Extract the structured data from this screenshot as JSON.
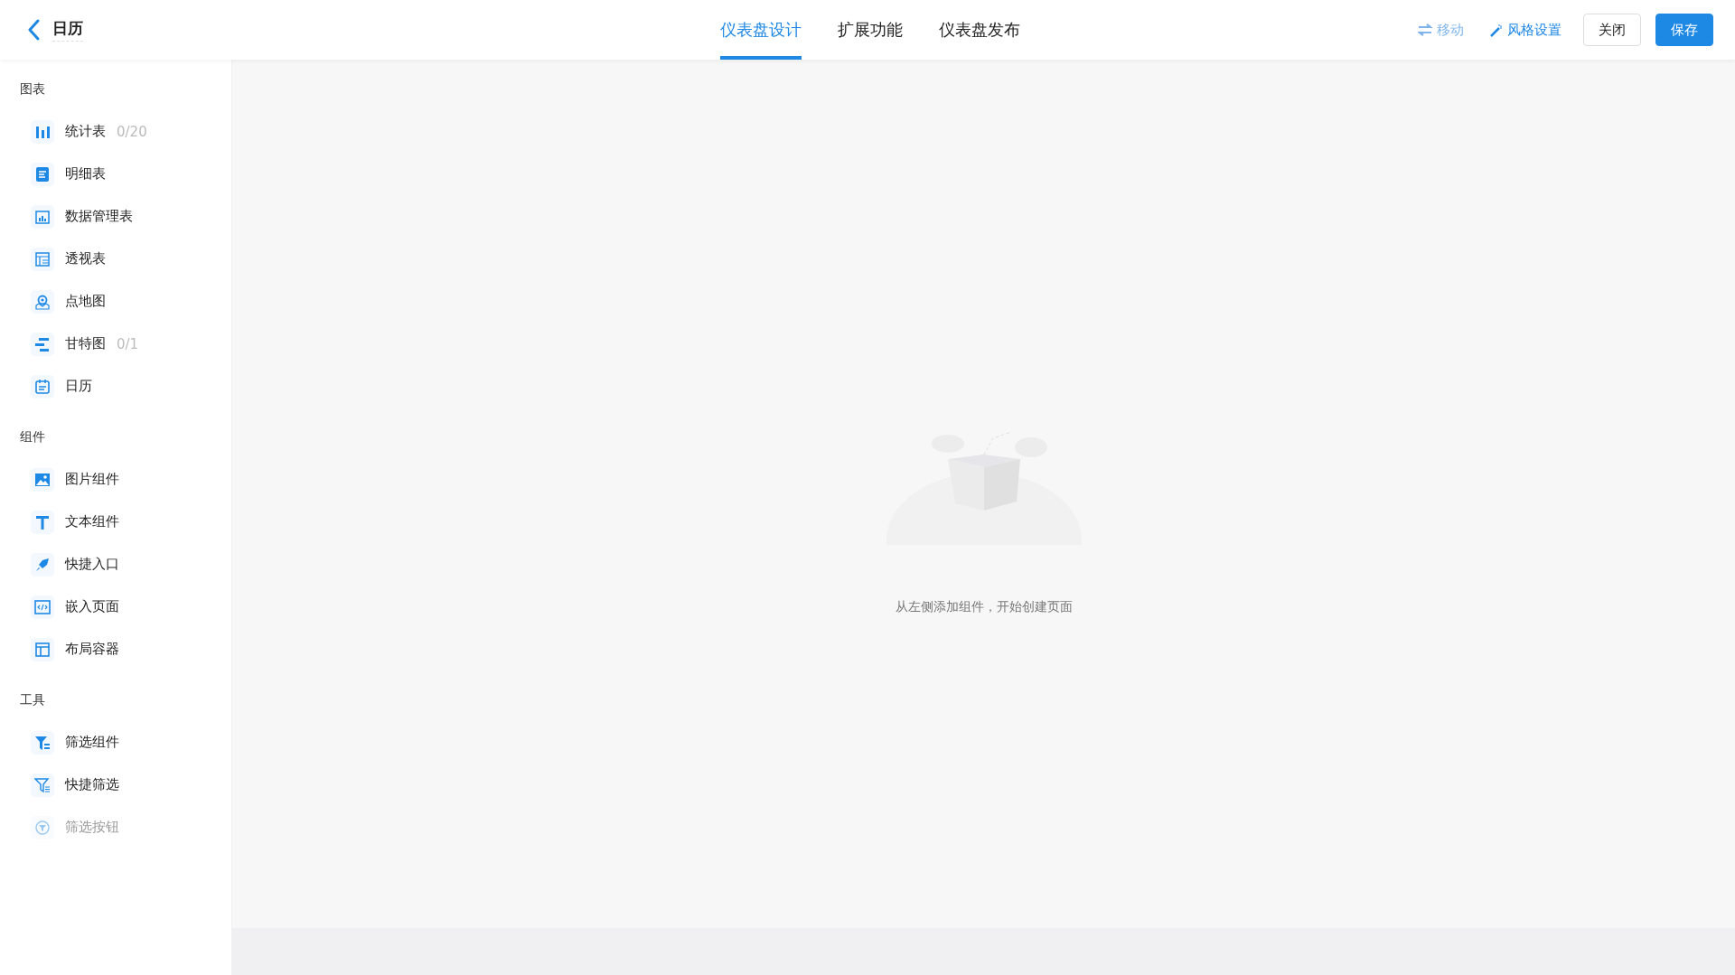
{
  "header": {
    "title": "日历",
    "tabs": [
      {
        "label": "仪表盘设计",
        "selected": true
      },
      {
        "label": "扩展功能",
        "selected": false
      },
      {
        "label": "仪表盘发布",
        "selected": false
      }
    ],
    "actions": [
      {
        "label": "移动",
        "disabled": true
      },
      {
        "label": "风格设置",
        "disabled": false
      }
    ],
    "buttons": [
      {
        "label": "关闭",
        "kind": "secondary"
      },
      {
        "label": "保存",
        "kind": "primary"
      }
    ]
  },
  "sidebar": {
    "sections": [
      {
        "title": "图表",
        "items": [
          {
            "label": "统计表",
            "count": "0/20",
            "disabled": false
          },
          {
            "label": "明细表",
            "disabled": false
          },
          {
            "label": "数据管理表",
            "disabled": false
          },
          {
            "label": "透视表",
            "disabled": false
          },
          {
            "label": "点地图",
            "disabled": false
          },
          {
            "label": "甘特图",
            "count": "0/1",
            "disabled": false
          },
          {
            "label": "日历",
            "disabled": false
          }
        ]
      },
      {
        "title": "组件",
        "items": [
          {
            "label": "图片组件",
            "disabled": false
          },
          {
            "label": "文本组件",
            "disabled": false
          },
          {
            "label": "快捷入口",
            "disabled": false
          },
          {
            "label": "嵌入页面",
            "disabled": false
          },
          {
            "label": "布局容器",
            "disabled": false
          }
        ]
      },
      {
        "title": "工具",
        "items": [
          {
            "label": "筛选组件",
            "disabled": false
          },
          {
            "label": "快捷筛选",
            "disabled": false
          },
          {
            "label": "筛选按钮",
            "disabled": true
          }
        ]
      }
    ]
  },
  "canvas": {
    "empty_message": "从左侧添加组件，开始创建页面"
  }
}
